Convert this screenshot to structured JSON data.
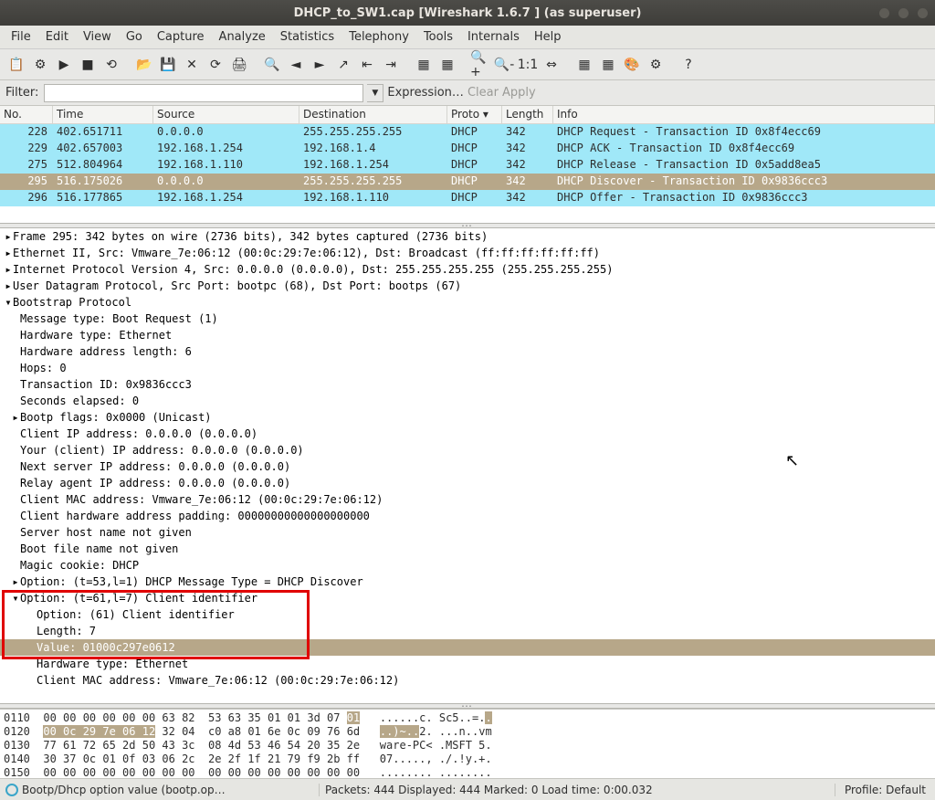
{
  "title": "DHCP_to_SW1.cap   [Wireshark 1.6.7 ] (as superuser)",
  "menu": [
    "File",
    "Edit",
    "View",
    "Go",
    "Capture",
    "Analyze",
    "Statistics",
    "Telephony",
    "Tools",
    "Internals",
    "Help"
  ],
  "filter": {
    "label": "Filter:",
    "value": "",
    "expression": "Expression…",
    "clear": "Clear",
    "apply": "Apply"
  },
  "columns": [
    "No.",
    "Time",
    "Source",
    "Destination",
    "Proto ▾",
    "Length",
    "Info"
  ],
  "packets": [
    {
      "no": "228",
      "time": "402.651711",
      "src": "0.0.0.0",
      "dst": "255.255.255.255",
      "proto": "DHCP",
      "len": "342",
      "info": "DHCP Request  - Transaction ID 0x8f4ecc69",
      "cls": "pl-cyan"
    },
    {
      "no": "229",
      "time": "402.657003",
      "src": "192.168.1.254",
      "dst": "192.168.1.4",
      "proto": "DHCP",
      "len": "342",
      "info": "DHCP ACK      - Transaction ID 0x8f4ecc69",
      "cls": "pl-cyan"
    },
    {
      "no": "275",
      "time": "512.804964",
      "src": "192.168.1.110",
      "dst": "192.168.1.254",
      "proto": "DHCP",
      "len": "342",
      "info": "DHCP Release  - Transaction ID 0x5add8ea5",
      "cls": "pl-cyan"
    },
    {
      "no": "295",
      "time": "516.175026",
      "src": "0.0.0.0",
      "dst": "255.255.255.255",
      "proto": "DHCP",
      "len": "342",
      "info": "DHCP Discover - Transaction ID 0x9836ccc3",
      "cls": "pl-brown"
    },
    {
      "no": "296",
      "time": "516.177865",
      "src": "192.168.1.254",
      "dst": "192.168.1.110",
      "proto": "DHCP",
      "len": "342",
      "info": "DHCP Offer    - Transaction ID 0x9836ccc3",
      "cls": "pl-cyan"
    }
  ],
  "details": {
    "frame": "Frame 295: 342 bytes on wire (2736 bits), 342 bytes captured (2736 bits)",
    "eth": "Ethernet II, Src: Vmware_7e:06:12 (00:0c:29:7e:06:12), Dst: Broadcast (ff:ff:ff:ff:ff:ff)",
    "ip": "Internet Protocol Version 4, Src: 0.0.0.0 (0.0.0.0), Dst: 255.255.255.255 (255.255.255.255)",
    "udp": "User Datagram Protocol, Src Port: bootpc (68), Dst Port: bootps (67)",
    "bootp": "Bootstrap Protocol",
    "msgtype": "Message type: Boot Request (1)",
    "hwtype": "Hardware type: Ethernet",
    "hwlen": "Hardware address length: 6",
    "hops": "Hops: 0",
    "tid": "Transaction ID: 0x9836ccc3",
    "secs": "Seconds elapsed: 0",
    "flags": "Bootp flags: 0x0000 (Unicast)",
    "cip": "Client IP address: 0.0.0.0 (0.0.0.0)",
    "yip": "Your (client) IP address: 0.0.0.0 (0.0.0.0)",
    "nip": "Next server IP address: 0.0.0.0 (0.0.0.0)",
    "rip": "Relay agent IP address: 0.0.0.0 (0.0.0.0)",
    "cmac": "Client MAC address: Vmware_7e:06:12 (00:0c:29:7e:06:12)",
    "pad": "Client hardware address padding: 00000000000000000000",
    "shn": "Server host name not given",
    "bfn": "Boot file name not given",
    "cookie": "Magic cookie: DHCP",
    "opt53": "Option: (t=53,l=1) DHCP Message Type = DHCP Discover",
    "opt61": "Option: (t=61,l=7) Client identifier",
    "opt61_opt": "Option: (61) Client identifier",
    "opt61_len": "Length: 7",
    "opt61_val": "Value: 01000c297e0612",
    "opt61_hwt": "Hardware type: Ethernet",
    "opt61_mac": "Client MAC address: Vmware_7e:06:12 (00:0c:29:7e:06:12)"
  },
  "hex": {
    "l1_off": "0110",
    "l1_hex_a": "00 00 00 00 00 00 63 82  53 63 35 01 01 3d 07 ",
    "l1_hex_b": "01",
    "l1_asc_a": "   ......c. Sc5..=.",
    "l1_asc_b": ".",
    "l2_off": "0120",
    "l2_hex_a": "00 0c 29 7e 06 12",
    "l2_hex_b": " 32 04  c0 a8 01 6e 0c 09 76 6d",
    "l2_asc_a": "..)~..",
    "l2_asc_b": "2. ...n..vm",
    "l3": "0130  77 61 72 65 2d 50 43 3c  08 4d 53 46 54 20 35 2e   ware-PC< .MSFT 5.",
    "l4": "0140  30 37 0c 01 0f 03 06 2c  2e 2f 1f 21 79 f9 2b ff   07....., ./.!y.+.",
    "l5": "0150  00 00 00 00 00 00 00 00  00 00 00 00 00 00 00 00   ........ ........"
  },
  "status": {
    "left": "Bootp/Dhcp option value (bootp.op…",
    "mid": "Packets: 444 Displayed: 444 Marked: 0 Load time: 0:00.032",
    "right": "Profile: Default"
  }
}
